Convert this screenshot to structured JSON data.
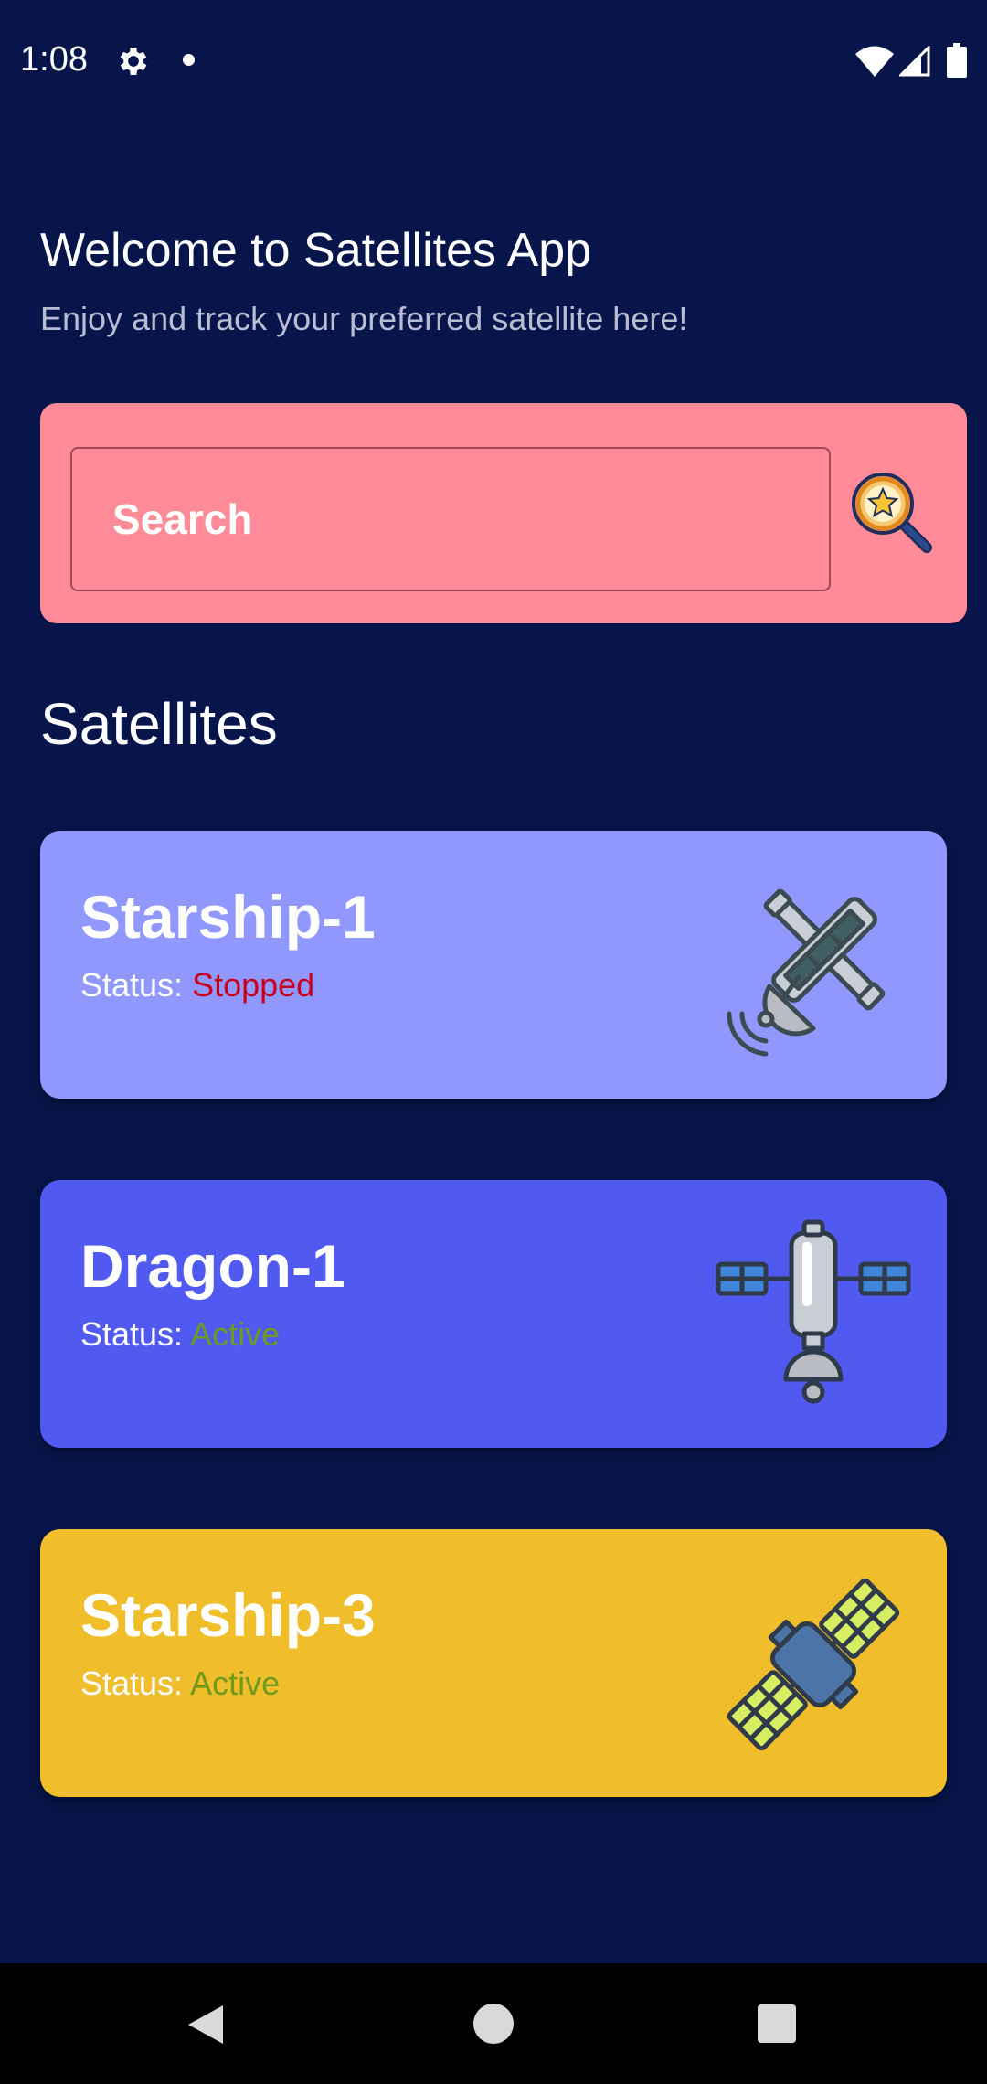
{
  "status_bar": {
    "time": "1:08",
    "icons": [
      "gear-icon",
      "notification-dot-icon",
      "wifi-icon",
      "signal-icon",
      "battery-icon"
    ]
  },
  "header": {
    "title": "Welcome to Satellites App",
    "subtitle": "Enjoy and track your preferred satellite here!"
  },
  "search": {
    "placeholder": "Search",
    "icon": "search-star-icon",
    "card_color": "#ff8a98"
  },
  "section": {
    "title": "Satellites"
  },
  "satellites": [
    {
      "name": "Starship-1",
      "status_label": "Status:",
      "status_value": "Stopped",
      "status_color": "#c8001b",
      "card_color": "#9098fd",
      "icon": "satellite-dish-icon"
    },
    {
      "name": "Dragon-1",
      "status_label": "Status:",
      "status_value": "Active",
      "status_color": "#6f9a1e",
      "card_color": "#505af0",
      "icon": "space-station-icon"
    },
    {
      "name": "Starship-3",
      "status_label": "Status:",
      "status_value": "Active",
      "status_color": "#6f9a1e",
      "card_color": "#f0bd2b",
      "icon": "satellite-solar-panels-icon"
    }
  ],
  "nav_bar": {
    "icons": [
      "back-icon",
      "home-icon",
      "recents-icon"
    ]
  },
  "colors": {
    "background": "#07154a",
    "subtitle": "#b8bdd4"
  }
}
